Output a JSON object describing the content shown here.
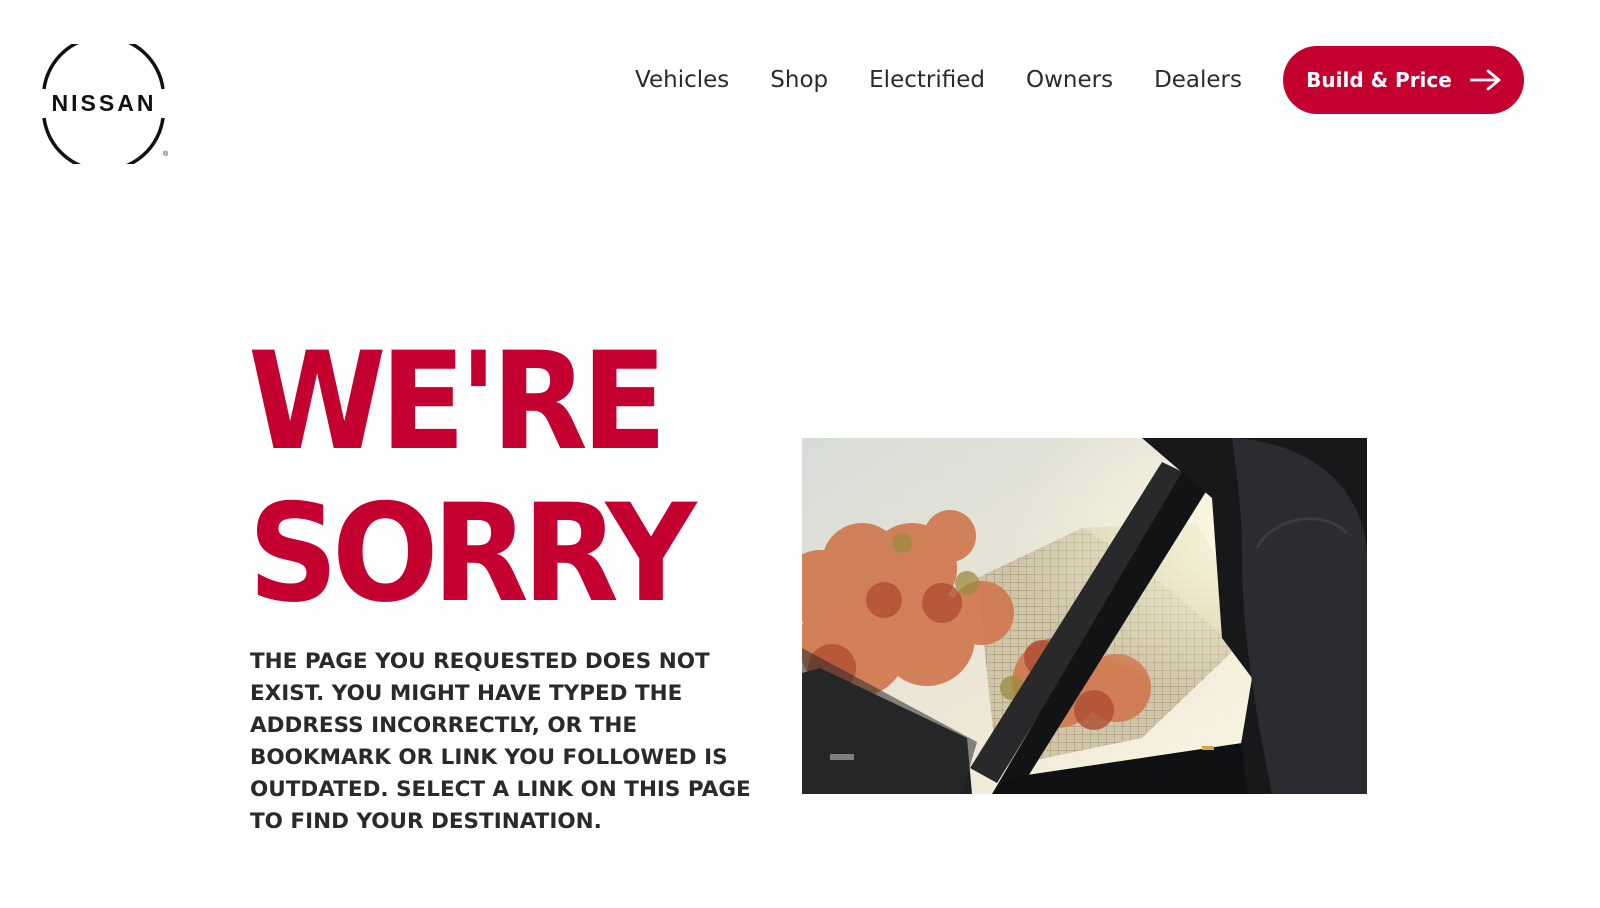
{
  "brand": {
    "logo_text": "NISSAN",
    "accent_color": "#c3002f",
    "text_color": "#2b2b2b"
  },
  "nav": {
    "items": [
      {
        "label": "Vehicles"
      },
      {
        "label": "Shop"
      },
      {
        "label": "Electrified"
      },
      {
        "label": "Owners"
      },
      {
        "label": "Dealers"
      }
    ],
    "cta": {
      "label": "Build & Price",
      "icon": "arrow-right-icon"
    }
  },
  "error_page": {
    "title_line1": "WE'RE",
    "title_line2": "SORRY",
    "message": "THE PAGE YOU REQUESTED DOES NOT EXIST. YOU MIGHT HAVE TYPED THE ADDRESS INCORRECTLY, OR THE BOOKMARK OR LINK YOU FOLLOWED IS OUTDATED. SELECT A LINK ON THIS PAGE TO FIND YOUR DESTINATION.",
    "image": "sunroof-photo"
  }
}
